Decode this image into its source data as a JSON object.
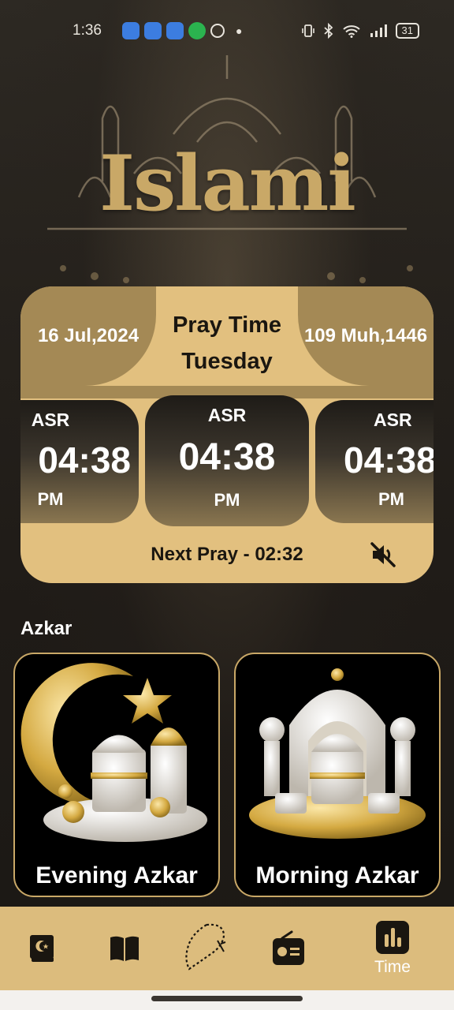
{
  "status_bar": {
    "time": "1:36",
    "battery": "31"
  },
  "app": {
    "logo_text": "Islami"
  },
  "pray_card": {
    "gregorian_date": "16 Jul,2024",
    "hijri_date": "109 Muh,1446",
    "title": "Pray Time",
    "weekday": "Tuesday",
    "slots": [
      {
        "name": "ASR",
        "time": "04:38",
        "ampm": "PM"
      },
      {
        "name": "ASR",
        "time": "04:38",
        "ampm": "PM"
      },
      {
        "name": "ASR",
        "time": "04:38",
        "ampm": "PM"
      }
    ],
    "next_pray": "Next Pray - 02:32",
    "mute_icon": "volume-off-icon"
  },
  "azkar": {
    "heading": "Azkar",
    "cards": [
      {
        "label": "Evening Azkar",
        "icon": "crescent-mosque-icon"
      },
      {
        "label": "Morning Azkar",
        "icon": "mosque-icon"
      }
    ]
  },
  "bottom_nav": {
    "items": [
      {
        "icon": "quran-icon",
        "label": ""
      },
      {
        "icon": "book-icon",
        "label": ""
      },
      {
        "icon": "sebha-icon",
        "label": ""
      },
      {
        "icon": "radio-icon",
        "label": ""
      },
      {
        "icon": "time-icon",
        "label": "Time"
      }
    ],
    "active_index": 4
  },
  "colors": {
    "gold": "#e2c07f",
    "gold_dark": "#a48955",
    "nav_bg": "#dcbc7d",
    "accent_border": "#c9a867"
  }
}
